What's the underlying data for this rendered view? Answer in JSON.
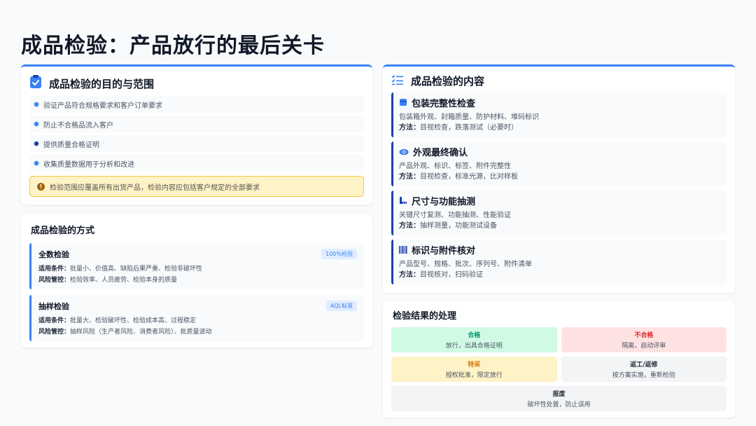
{
  "page_title": "成品检验：产品放行的最后关卡",
  "colors": {
    "accent": "#3b82f6",
    "dark_accent": "#1e40af",
    "warning_bg": "#fef3c7"
  },
  "purpose": {
    "title": "成品检验的目的与范围",
    "icon": "clipboard-check-icon",
    "items": [
      "验证产品符合规格要求和客户订单要求",
      "防止不合格品流入客户",
      "提供质量合格证明",
      "收集质量数据用于分析和改进"
    ],
    "notice": "检验范围应覆盖所有出货产品，检验内容应包括客户规定的全部要求"
  },
  "methods": {
    "title": "成品检验的方式",
    "items": [
      {
        "name": "全数检验",
        "tag": "100%检验",
        "cond_label": "适用条件：",
        "cond": "批量小、价值高、缺陷后果严重、检验非破坏性",
        "risk_label": "风险管控：",
        "risk": "检验效率、人员疲劳、检验本身的质量"
      },
      {
        "name": "抽样检验",
        "tag": "AQL标准",
        "cond_label": "适用条件：",
        "cond": "批量大、检验破坏性、检验成本高、过程稳定",
        "risk_label": "风险管控：",
        "risk": "抽样风险（生产者风险、消费者风险）、批质量波动"
      }
    ]
  },
  "content": {
    "title": "成品检验的内容",
    "icon": "checklist-icon",
    "method_label": "方法：",
    "items": [
      {
        "icon": "box-icon",
        "title": "包装完整性检查",
        "desc": "包装箱外观、封箱质量、防护材料、堆码标识",
        "method": "目视检查，跌落测试（必要时）"
      },
      {
        "icon": "eye-icon",
        "title": "外观最终确认",
        "desc": "产品外观、标识、标签、附件完整性",
        "method": "目视检查，标准光源，比对样板"
      },
      {
        "icon": "ruler-icon",
        "title": "尺寸与功能抽测",
        "desc": "关键尺寸复测、功能抽测、性能验证",
        "method": "抽样测量，功能测试设备"
      },
      {
        "icon": "barcode-icon",
        "title": "标识与附件核对",
        "desc": "产品型号、规格、批次、序列号、附件清单",
        "method": "目视核对，扫码验证"
      }
    ]
  },
  "results": {
    "title": "检验结果的处理",
    "items": [
      {
        "name": "合格",
        "desc": "放行，出具合格证明",
        "kind": "ok"
      },
      {
        "name": "不合格",
        "desc": "隔离，启动评审",
        "kind": "ng"
      },
      {
        "name": "特采",
        "desc": "授权批准，限定放行",
        "kind": "sp"
      },
      {
        "name": "返工/返修",
        "desc": "按方案实施，重新检验",
        "kind": "rw"
      },
      {
        "name": "报废",
        "desc": "破坏性处置，防止误用",
        "kind": "sc"
      }
    ]
  }
}
